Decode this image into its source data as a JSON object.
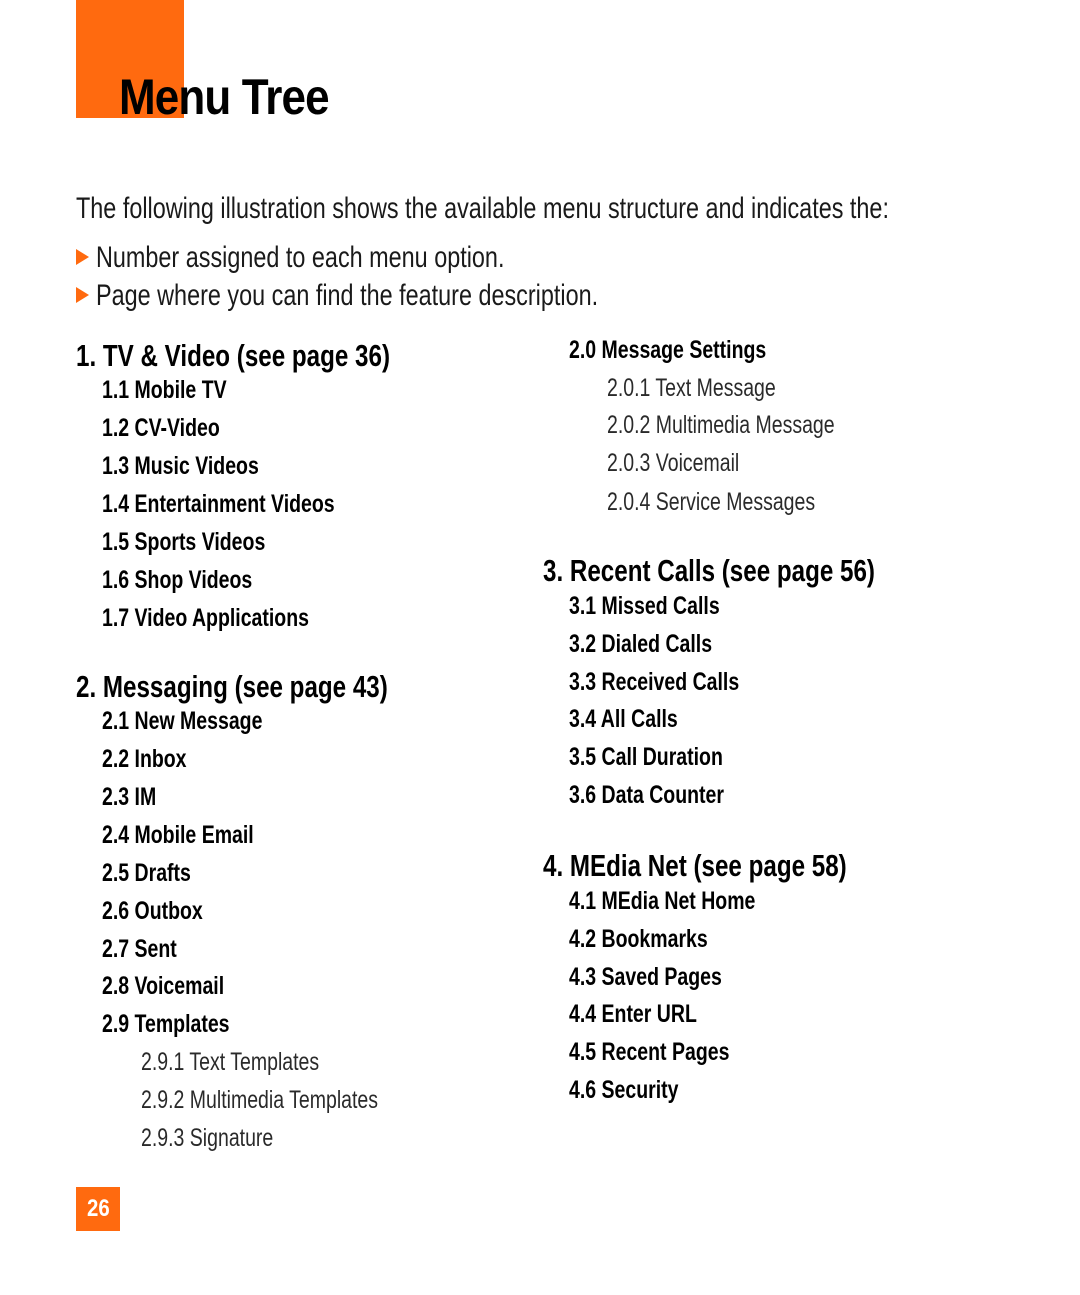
{
  "header": {
    "title": "Menu Tree",
    "accent_color": "#ff6a0f"
  },
  "intro": {
    "text": "The following illustration shows the available menu structure and indicates the:",
    "bullets": [
      "Number assigned to each menu option.",
      "Page where you can find the feature description."
    ]
  },
  "menu": {
    "left": [
      {
        "level": 1,
        "text": "1. TV & Video (see page 36)"
      },
      {
        "level": 2,
        "text": "1.1 Mobile TV"
      },
      {
        "level": 2,
        "text": "1.2 CV-Video"
      },
      {
        "level": 2,
        "text": "1.3 Music Videos"
      },
      {
        "level": 2,
        "text": "1.4 Entertainment Videos"
      },
      {
        "level": 2,
        "text": "1.5 Sports Videos"
      },
      {
        "level": 2,
        "text": "1.6 Shop Videos"
      },
      {
        "level": 2,
        "text": "1.7 Video Applications"
      },
      {
        "level": 1,
        "text": "2. Messaging (see page 43)"
      },
      {
        "level": 2,
        "text": "2.1 New Message"
      },
      {
        "level": 2,
        "text": "2.2 Inbox"
      },
      {
        "level": 2,
        "text": "2.3 IM"
      },
      {
        "level": 2,
        "text": "2.4 Mobile Email"
      },
      {
        "level": 2,
        "text": "2.5 Drafts"
      },
      {
        "level": 2,
        "text": "2.6 Outbox"
      },
      {
        "level": 2,
        "text": "2.7 Sent"
      },
      {
        "level": 2,
        "text": "2.8 Voicemail"
      },
      {
        "level": 2,
        "text": "2.9 Templates"
      },
      {
        "level": 3,
        "text": "2.9.1 Text Templates"
      },
      {
        "level": 3,
        "text": "2.9.2 Multimedia Templates"
      },
      {
        "level": 3,
        "text": "2.9.3 Signature"
      }
    ],
    "right": [
      {
        "level": 2,
        "text": "2.0 Message Settings"
      },
      {
        "level": 3,
        "text": "2.0.1 Text Message"
      },
      {
        "level": 3,
        "text": "2.0.2 Multimedia Message"
      },
      {
        "level": 3,
        "text": "2.0.3 Voicemail"
      },
      {
        "level": 3,
        "text": "2.0.4 Service Messages"
      },
      {
        "level": 1,
        "text": "3. Recent Calls (see page 56)"
      },
      {
        "level": 2,
        "text": "3.1 Missed Calls"
      },
      {
        "level": 2,
        "text": "3.2 Dialed Calls"
      },
      {
        "level": 2,
        "text": "3.3 Received Calls"
      },
      {
        "level": 2,
        "text": "3.4 All Calls"
      },
      {
        "level": 2,
        "text": "3.5 Call Duration"
      },
      {
        "level": 2,
        "text": "3.6 Data Counter"
      },
      {
        "level": 1,
        "text": "4. MEdia Net (see page 58)"
      },
      {
        "level": 2,
        "text": "4.1 MEdia Net Home"
      },
      {
        "level": 2,
        "text": "4.2 Bookmarks"
      },
      {
        "level": 2,
        "text": "4.3 Saved Pages"
      },
      {
        "level": 2,
        "text": "4.4 Enter URL"
      },
      {
        "level": 2,
        "text": "4.5 Recent Pages"
      },
      {
        "level": 2,
        "text": "4.6 Security"
      }
    ]
  },
  "footer": {
    "page_number": "26"
  }
}
